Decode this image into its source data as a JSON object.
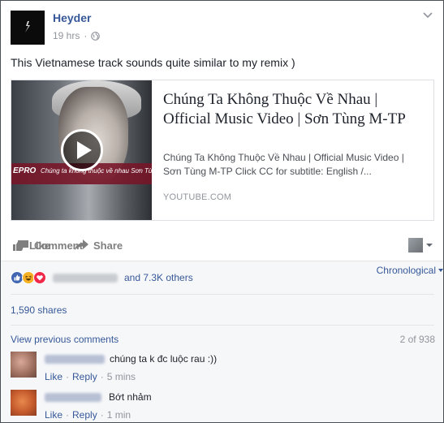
{
  "post": {
    "author": "Heyder",
    "time": "19 hrs",
    "separator": "·",
    "text": "This Vietnamese track sounds quite similar to my remix )"
  },
  "link_preview": {
    "title": "Chúng Ta Không Thuộc Về Nhau | Official Music Video | Sơn Tùng M-TP",
    "description": "Chúng Ta Không Thuộc Về Nhau | Official Music Video | Sơn Tùng M-TP Click CC for subtitle: English /...",
    "domain": "YOUTUBE.COM",
    "thumbnail_brand": "EPRO",
    "thumbnail_caption": "Chúng ta không thuộc về nhau  Sơn Tùng"
  },
  "actions": {
    "like": "Like",
    "comment": "Comment",
    "share": "Share"
  },
  "reactions": {
    "others": "and 7.3K others",
    "sort": "Chronological",
    "icons": [
      "like-icon",
      "haha-icon",
      "love-icon"
    ]
  },
  "shares": "1,590 shares",
  "comments_nav": {
    "view_previous": "View previous comments",
    "count": "2 of 938"
  },
  "comments": [
    {
      "text": "chúng ta k đc luộc rau :))",
      "like": "Like",
      "reply": "Reply",
      "time": "5 mins",
      "avatar_color": "#b07a6a"
    },
    {
      "text": "Bớt nhảm",
      "like": "Like",
      "reply": "Reply",
      "time": "1 min",
      "avatar_color": "#c9663f"
    }
  ],
  "colors": {
    "link": "#365899",
    "meta": "#90949c",
    "feedback_bg": "#f6f7f9",
    "like_blue": "#4267b2"
  }
}
